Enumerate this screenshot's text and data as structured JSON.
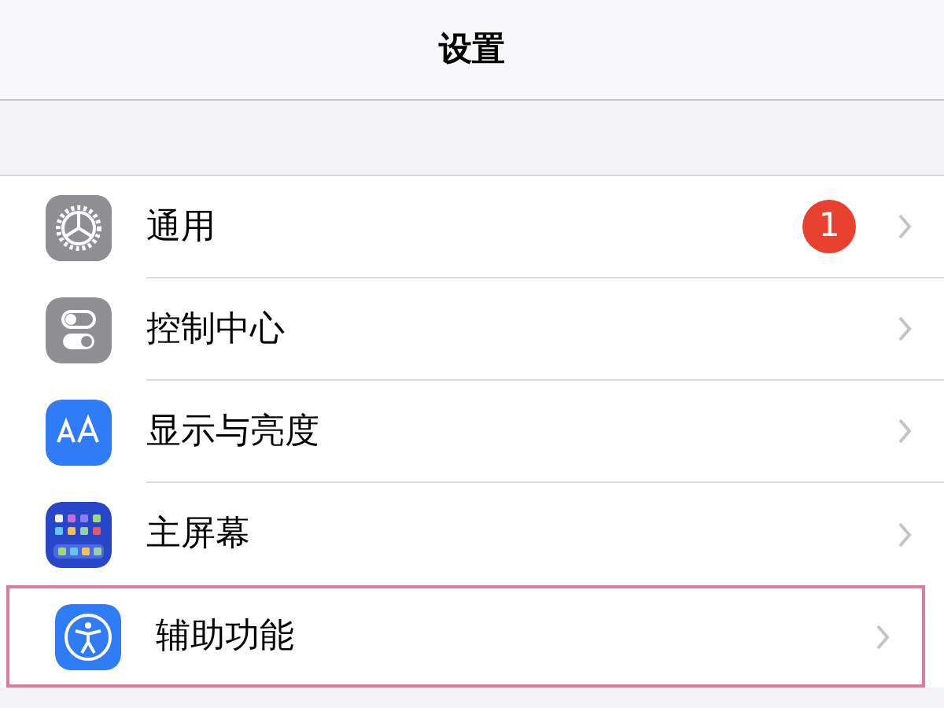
{
  "nav_bar": {
    "title": "设置"
  },
  "settings": [
    {
      "label": "通用",
      "kind": "gear",
      "badge": "1",
      "highlighted": false
    },
    {
      "label": "控制中心",
      "kind": "toggles",
      "highlighted": false
    },
    {
      "label": "显示与亮度",
      "kind": "text-size",
      "highlighted": false
    },
    {
      "label": "主屏幕",
      "kind": "app-grid",
      "highlighted": false
    },
    {
      "label": "辅助功能",
      "kind": "accessibility",
      "highlighted": true
    }
  ]
}
